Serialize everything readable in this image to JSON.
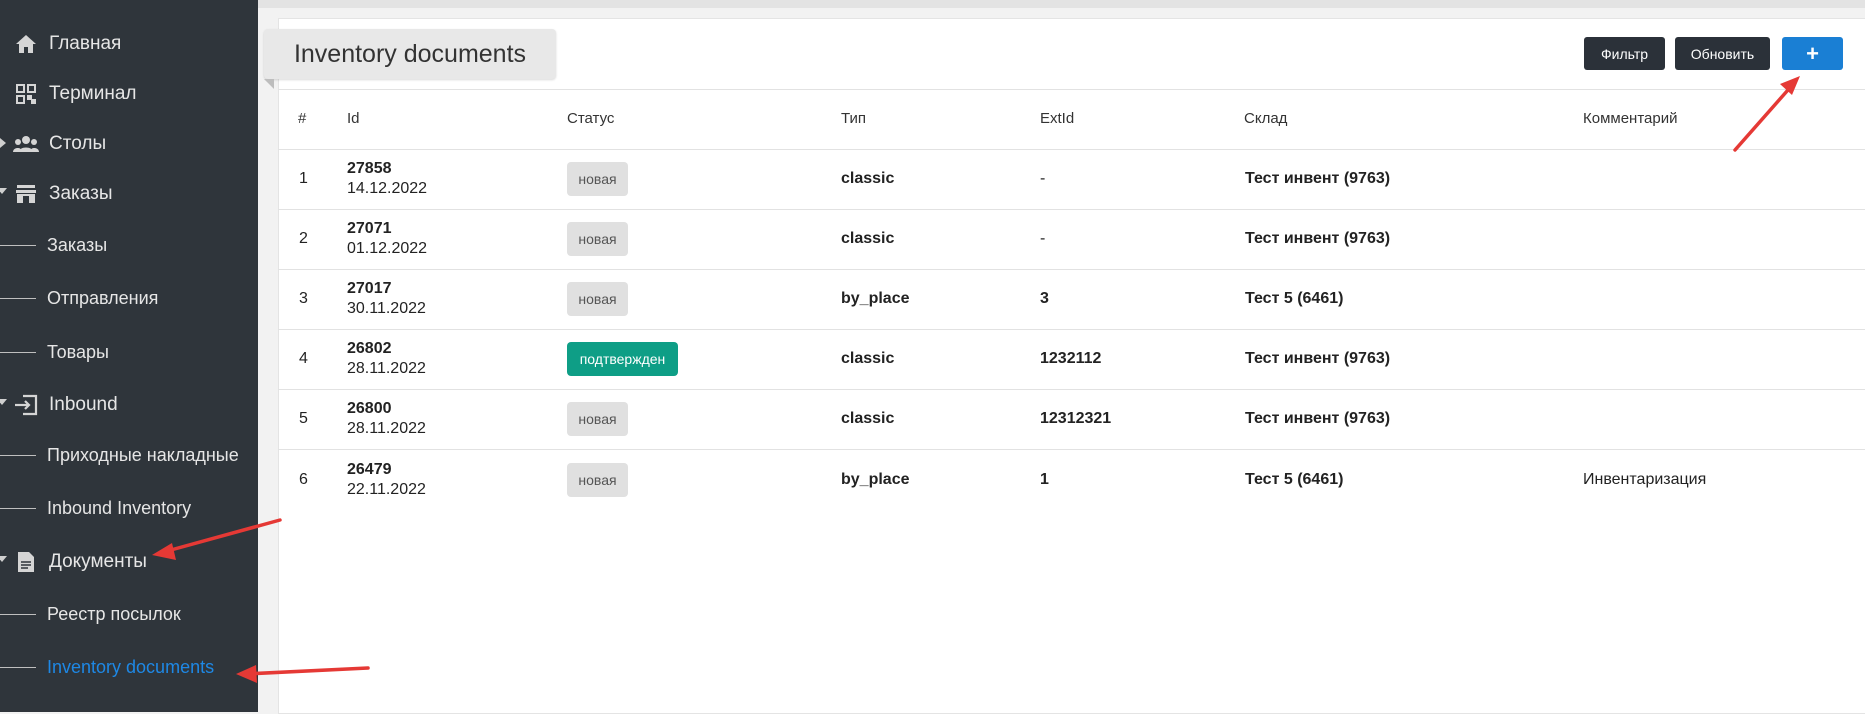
{
  "sidebar": {
    "items": [
      {
        "label": "Главная"
      },
      {
        "label": "Терминал"
      },
      {
        "label": "Столы"
      },
      {
        "label": "Заказы"
      },
      {
        "label": "Заказы"
      },
      {
        "label": "Отправления"
      },
      {
        "label": "Товары"
      },
      {
        "label": "Inbound"
      },
      {
        "label": "Приходные накладные"
      },
      {
        "label": "Inbound Inventory"
      },
      {
        "label": "Документы"
      },
      {
        "label": "Реестр посылок"
      },
      {
        "label": "Inventory documents"
      }
    ]
  },
  "page": {
    "title": "Inventory documents",
    "buttons": {
      "filter": "Фильтр",
      "refresh": "Обновить",
      "add": "+"
    }
  },
  "table": {
    "headers": [
      "#",
      "Id",
      "Статус",
      "Тип",
      "ExtId",
      "Склад",
      "Комментарий"
    ],
    "rows": [
      {
        "num": "1",
        "id": "27858",
        "date": "14.12.2022",
        "status": "новая",
        "type": "classic",
        "extid": "-",
        "warehouse": "Тест инвент (9763)",
        "comment": ""
      },
      {
        "num": "2",
        "id": "27071",
        "date": "01.12.2022",
        "status": "новая",
        "type": "classic",
        "extid": "-",
        "warehouse": "Тест инвент (9763)",
        "comment": ""
      },
      {
        "num": "3",
        "id": "27017",
        "date": "30.11.2022",
        "status": "новая",
        "type": "by_place",
        "extid": "3",
        "warehouse": "Тест 5 (6461)",
        "comment": ""
      },
      {
        "num": "4",
        "id": "26802",
        "date": "28.11.2022",
        "status": "подтвержден",
        "type": "classic",
        "extid": "1232112",
        "warehouse": "Тест инвент (9763)",
        "comment": ""
      },
      {
        "num": "5",
        "id": "26800",
        "date": "28.11.2022",
        "status": "новая",
        "type": "classic",
        "extid": "12312321",
        "warehouse": "Тест инвент (9763)",
        "comment": ""
      },
      {
        "num": "6",
        "id": "26479",
        "date": "22.11.2022",
        "status": "новая",
        "type": "by_place",
        "extid": "1",
        "warehouse": "Тест 5 (6461)",
        "comment": "Инвентаризация"
      }
    ]
  },
  "colors": {
    "sidebar_bg": "#2f353b",
    "active_link": "#1e88e5",
    "primary": "#1a7fd4",
    "confirmed_badge": "#0e9e86",
    "annotation_arrow": "#e53935"
  }
}
